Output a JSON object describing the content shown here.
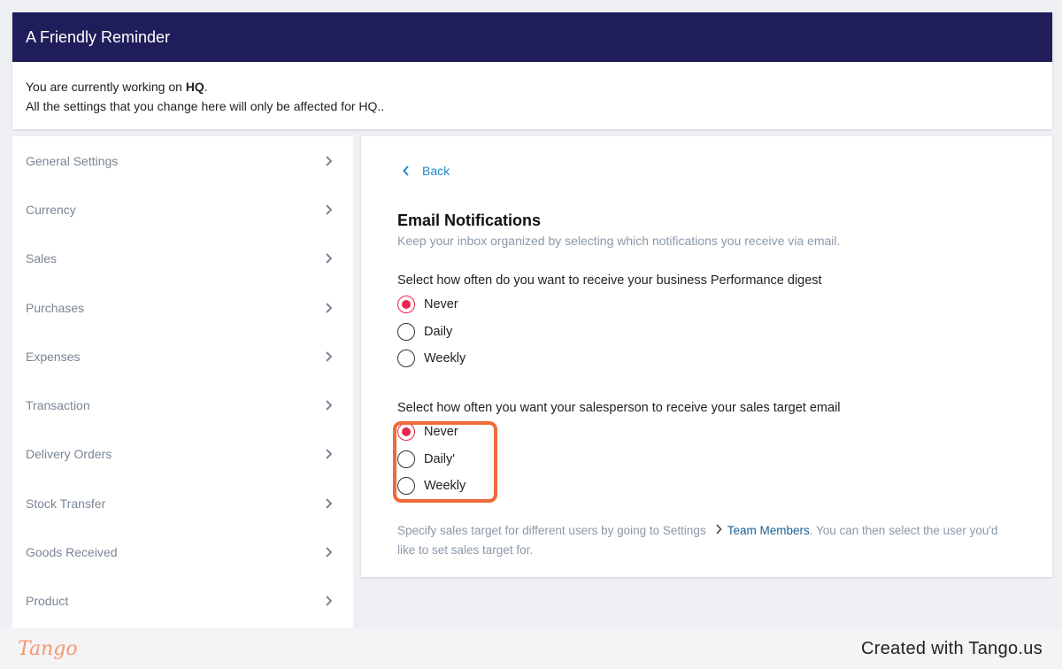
{
  "reminder": {
    "title": "A Friendly Reminder",
    "line1_prefix": "You are currently working on ",
    "line1_bold": "HQ",
    "line1_suffix": ".",
    "line2": "All the settings that you change here will only be affected for HQ.."
  },
  "sidebar": {
    "items": [
      {
        "label": "General Settings"
      },
      {
        "label": "Currency"
      },
      {
        "label": "Sales"
      },
      {
        "label": "Purchases"
      },
      {
        "label": "Expenses"
      },
      {
        "label": "Transaction"
      },
      {
        "label": "Delivery Orders"
      },
      {
        "label": "Stock Transfer"
      },
      {
        "label": "Goods Received"
      },
      {
        "label": "Product"
      }
    ]
  },
  "content": {
    "back_label": "Back",
    "title": "Email Notifications",
    "subtitle": "Keep your inbox organized by selecting which notifications you receive via email.",
    "q1": {
      "label": "Select how often do you want to receive your business Performance digest",
      "options": [
        "Never",
        "Daily",
        "Weekly"
      ],
      "selected": "Never"
    },
    "q2": {
      "label": "Select how often you want your salesperson to receive your sales target email",
      "options": [
        "Never",
        "Daily'",
        "Weekly"
      ],
      "selected": "Never"
    },
    "note": {
      "prefix": "Specify sales target for different users by going to Settings",
      "link": "Team Members",
      "suffix": ". You can then select the user you'd like to set sales target for."
    }
  },
  "footer": {
    "logo": "Tango",
    "created": "Created with Tango.us"
  },
  "colors": {
    "header_bg": "#1f1e5a",
    "accent_radio": "#e9264f",
    "link": "#1f88c9",
    "highlight": "#ef6b3a"
  }
}
